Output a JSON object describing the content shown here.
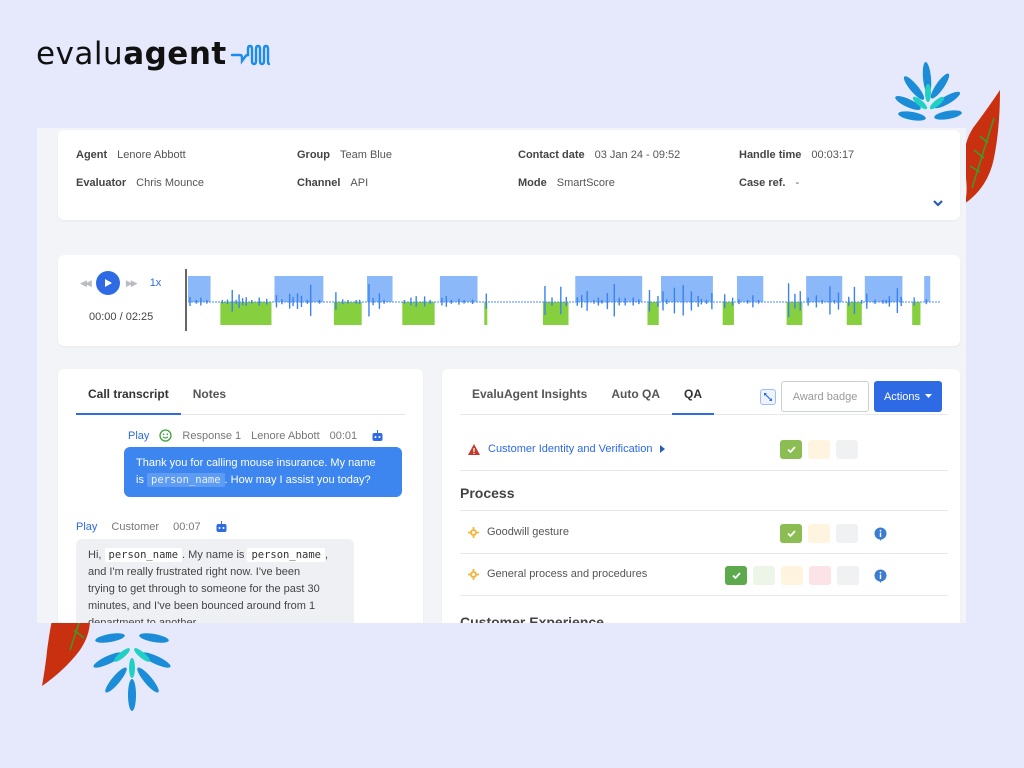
{
  "brand": {
    "logo_light": "evalu",
    "logo_bold": "agent",
    "logo_icon": "wave-signal-icon",
    "accent": "#2d6ae3"
  },
  "contact_info": {
    "agent": {
      "label": "Agent",
      "value": "Lenore Abbott"
    },
    "evaluator": {
      "label": "Evaluator",
      "value": "Chris Mounce"
    },
    "group": {
      "label": "Group",
      "value": "Team Blue"
    },
    "channel": {
      "label": "Channel",
      "value": "API"
    },
    "contact_date": {
      "label": "Contact date",
      "value": "03 Jan 24 - 09:52"
    },
    "mode": {
      "label": "Mode",
      "value": "SmartScore"
    },
    "handle_time": {
      "label": "Handle time",
      "value": "00:03:17"
    },
    "case_ref": {
      "label": "Case ref.",
      "value": "-"
    }
  },
  "player": {
    "speed": "1x",
    "time": "00:00 / 02:25",
    "current_seconds": 0,
    "duration_seconds": 145,
    "agent_color": "#8bb8f8",
    "customer_color": "#86d03f",
    "agent_segments": [
      [
        0.0,
        0.03
      ],
      [
        0.115,
        0.18
      ],
      [
        0.238,
        0.272
      ],
      [
        0.335,
        0.385
      ],
      [
        0.515,
        0.604
      ],
      [
        0.629,
        0.698
      ],
      [
        0.73,
        0.765
      ],
      [
        0.822,
        0.87
      ],
      [
        0.9,
        0.95
      ],
      [
        0.979,
        0.987
      ]
    ],
    "customer_segments": [
      [
        0.043,
        0.111
      ],
      [
        0.194,
        0.231
      ],
      [
        0.285,
        0.328
      ],
      [
        0.394,
        0.398
      ],
      [
        0.472,
        0.506
      ],
      [
        0.611,
        0.626
      ],
      [
        0.711,
        0.726
      ],
      [
        0.796,
        0.817
      ],
      [
        0.876,
        0.896
      ],
      [
        0.963,
        0.974
      ]
    ]
  },
  "transcript": {
    "tabs": [
      {
        "label": "Call transcript",
        "active": true
      },
      {
        "label": "Notes",
        "active": false
      }
    ],
    "messages": [
      {
        "play": "Play",
        "sentiment_icon": "smiley-icon",
        "response": "Response 1",
        "speaker": "Lenore Abbott",
        "time": "00:01",
        "line1_a": "Thank you for calling mouse insurance. My name",
        "line2_a": "is ",
        "line2_code": "person_name",
        "line2_b": ". How may I assist you today?"
      },
      {
        "play": "Play",
        "speaker": "Customer",
        "time": "00:07",
        "line1_a": "Hi, ",
        "line1_code1": "person_name",
        "line1_b": ". My name is ",
        "line1_code2": "person_name",
        "line1_c": ",",
        "line2": "and I'm really frustrated right now. I've been",
        "line3": "trying to get through to someone for the past 30",
        "line4": "minutes, and I've been bounced around from 1",
        "line5": "department to another."
      }
    ]
  },
  "qa": {
    "tabs": [
      {
        "label": "EvaluAgent Insights",
        "active": false
      },
      {
        "label": "Auto QA",
        "active": false
      },
      {
        "label": "QA",
        "active": true
      }
    ],
    "award_badge": "Award badge",
    "actions": "Actions",
    "critical_item": {
      "label": "Customer Identity and Verification",
      "selected_score": 0
    },
    "sections": [
      {
        "title": "Process",
        "items": [
          {
            "label": "Goodwill gesture",
            "selected_score": 0,
            "options": 3
          },
          {
            "label": "General process and procedures",
            "selected_score": 0,
            "options": 5
          }
        ]
      },
      {
        "title": "Customer Experience",
        "items": []
      }
    ]
  }
}
